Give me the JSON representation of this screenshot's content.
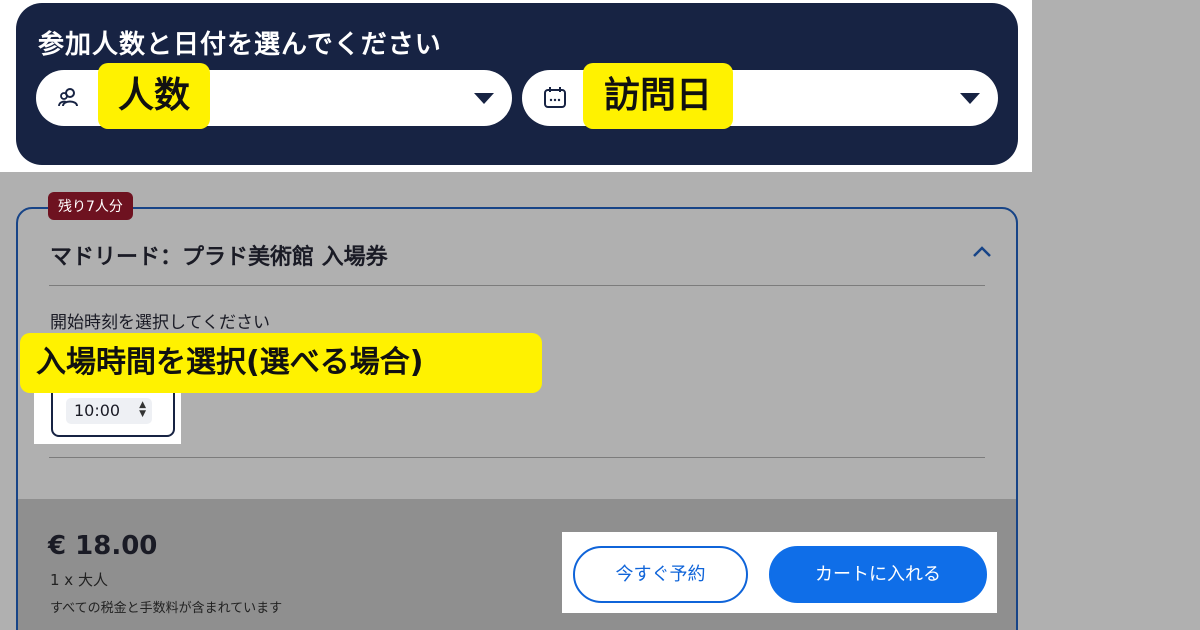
{
  "top_panel": {
    "title": "参加人数と日付を選んでください",
    "participants_tag": "人数",
    "date_tag": "訪問日",
    "participants_icon": "people-icon",
    "date_icon": "calendar-icon"
  },
  "product": {
    "remaining_badge": "残り7人分",
    "title": "マドリード：プラド美術館 入場券",
    "start_time_label": "開始時刻を選択してください",
    "time_annotation": "入場時間を選択(選べる場合)",
    "selected_time": "10:00",
    "price": "€ 18.00",
    "quantity": "1 x 大人",
    "tax_note": "すべての税金と手数料が含まれています",
    "book_now_label": "今すぐ予約",
    "add_to_cart_label": "カートに入れる"
  },
  "colors": {
    "panel_navy": "#172343",
    "highlight_yellow": "#fff200",
    "badge_red": "#6e1220",
    "primary_blue": "#0f6ee8"
  }
}
